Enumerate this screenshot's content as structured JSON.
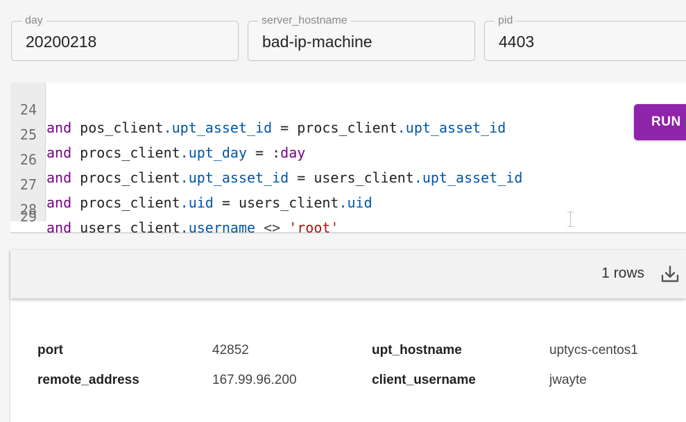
{
  "params": [
    {
      "label": "day",
      "value": "20200218"
    },
    {
      "label": "server_hostname",
      "value": "bad-ip-machine"
    },
    {
      "label": "pid",
      "value": "4403"
    }
  ],
  "editor": {
    "lines": [
      {
        "num": "24",
        "tokens": [
          "and",
          " pos_client",
          ".upt_asset_id",
          " = procs_client",
          ".upt_asset_id"
        ]
      },
      {
        "num": "25",
        "tokens": [
          "and",
          " procs_client",
          ".upt_day",
          " = :",
          "day"
        ]
      },
      {
        "num": "26",
        "tokens": [
          "and",
          " procs_client",
          ".upt_asset_id",
          " = users_client",
          ".upt_asset_id"
        ]
      },
      {
        "num": "27",
        "tokens": [
          "and",
          " procs_client",
          ".uid",
          " = users_client",
          ".uid"
        ]
      },
      {
        "num": "28",
        "tokens": [
          "and",
          " users_client",
          ".username",
          " <> ",
          "'root'"
        ]
      },
      {
        "num": "29",
        "tokens": []
      }
    ]
  },
  "run_button": {
    "label": "RUN"
  },
  "results": {
    "row_count_label": "1 rows",
    "fields": [
      {
        "key": "port",
        "value": "42852"
      },
      {
        "key": "remote_address",
        "value": "167.99.96.200"
      },
      {
        "key": "upt_hostname",
        "value": "uptycs-centos1"
      },
      {
        "key": "client_username",
        "value": "jwayte"
      }
    ]
  },
  "colors": {
    "keyword": "#770088",
    "property": "#0055aa",
    "string": "#aa1111",
    "run_button": "#8e24aa"
  },
  "icons": {
    "download": "download-icon"
  }
}
